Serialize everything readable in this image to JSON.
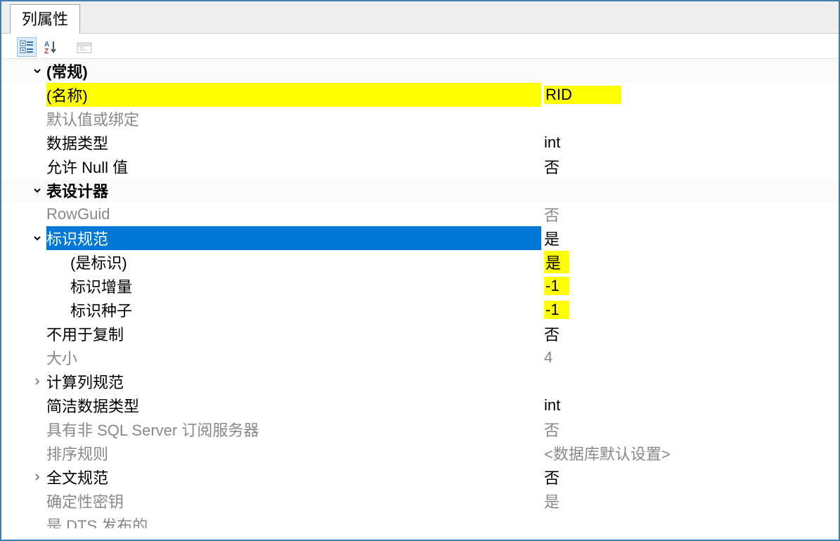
{
  "tab": {
    "title": "列属性"
  },
  "toolbar": {
    "categorized_tip": "按分类",
    "alphabetical_tip": "按字母",
    "property_pages_tip": "属性页"
  },
  "categories": {
    "general": "(常规)",
    "designer": "表设计器"
  },
  "props": {
    "name": {
      "label": "(名称)",
      "value": "RID"
    },
    "default": {
      "label": "默认值或绑定",
      "value": ""
    },
    "datatype": {
      "label": "数据类型",
      "value": "int"
    },
    "allow_null": {
      "label": "允许 Null 值",
      "value": "否"
    },
    "rowguid": {
      "label": "RowGuid",
      "value": "否"
    },
    "identity_spec": {
      "label": "标识规范",
      "value": "是"
    },
    "is_identity": {
      "label": "(是标识)",
      "value": "是"
    },
    "identity_increment": {
      "label": "标识增量",
      "value": "-1"
    },
    "identity_seed": {
      "label": "标识种子",
      "value": "-1"
    },
    "not_for_repl": {
      "label": "不用于复制",
      "value": "否"
    },
    "size": {
      "label": "大小",
      "value": "4"
    },
    "computed_spec": {
      "label": "计算列规范",
      "value": ""
    },
    "condensed_type": {
      "label": "简洁数据类型",
      "value": "int"
    },
    "non_sql_subscriber": {
      "label": "具有非 SQL Server 订阅服务器",
      "value": "否"
    },
    "collation": {
      "label": "排序规则",
      "value": "<数据库默认设置>"
    },
    "fulltext_spec": {
      "label": "全文规范",
      "value": "否"
    },
    "deterministic": {
      "label": "确定性密钥",
      "value": "是"
    },
    "dts_published": {
      "label": "是 DTS 发布的",
      "value": ""
    }
  }
}
